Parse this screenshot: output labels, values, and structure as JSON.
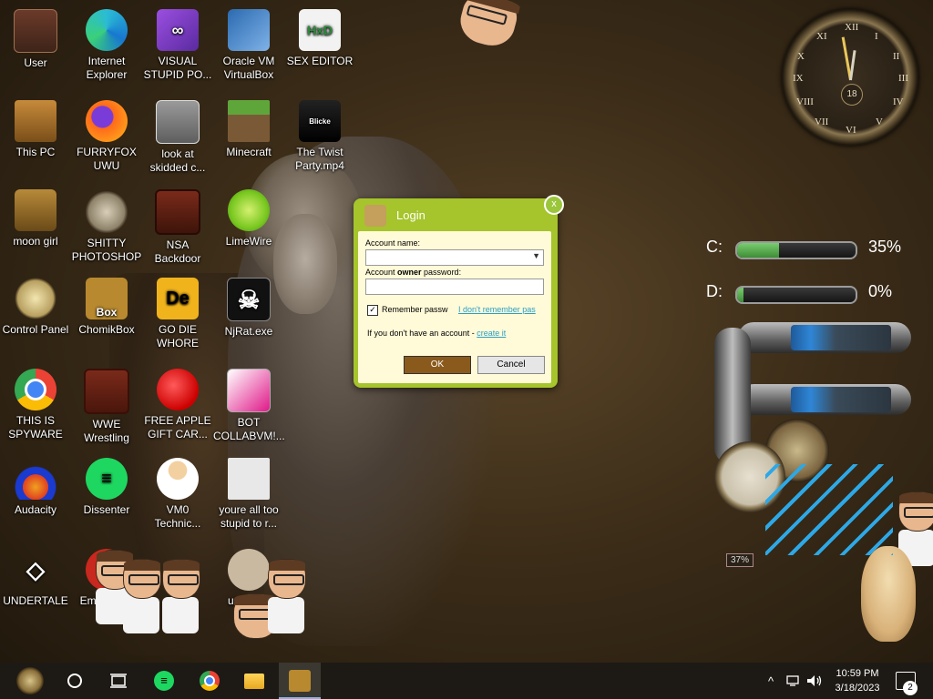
{
  "desktop": {
    "icons": [
      {
        "label": "User"
      },
      {
        "label": "Internet Explorer"
      },
      {
        "label": "VISUAL STUPID PO..."
      },
      {
        "label": "Oracle VM VirtualBox"
      },
      {
        "label": "SEX EDITOR"
      },
      {
        "label": "This PC"
      },
      {
        "label": "FURRYFOX UWU"
      },
      {
        "label": "look at skidded c..."
      },
      {
        "label": "Minecraft"
      },
      {
        "label": "The Twist Party.mp4"
      },
      {
        "label": "moon girl"
      },
      {
        "label": "SHITTY PHOTOSHOP"
      },
      {
        "label": "NSA Backdoor"
      },
      {
        "label": "LimeWire"
      },
      {
        "label": "Control Panel"
      },
      {
        "label": "ChomikBox"
      },
      {
        "label": "GO DIE WHORE"
      },
      {
        "label": "NjRat.exe"
      },
      {
        "label": "THIS IS SPYWARE"
      },
      {
        "label": "WWE Wrestling"
      },
      {
        "label": "FREE APPLE GIFT CAR..."
      },
      {
        "label": "BOT COLLABVM!..."
      },
      {
        "label": "Audacity"
      },
      {
        "label": "Dissenter"
      },
      {
        "label": "VM0 Technic..."
      },
      {
        "label": "youre all too stupid to r..."
      },
      {
        "label": "UNDERTALE"
      },
      {
        "label": "Emba Devi"
      },
      {
        "label": "us that b"
      }
    ],
    "icon_glyphs": {
      "hxd": "HxD",
      "chomik": "Box",
      "de": "De",
      "skull": "☠",
      "twist": "Blicke"
    }
  },
  "widgets": {
    "clock": {
      "numerals": [
        "XII",
        "I",
        "II",
        "III",
        "IV",
        "V",
        "VI",
        "VII",
        "VIII",
        "IX",
        "X",
        "XI"
      ],
      "date": "18"
    },
    "drives": [
      {
        "letter": "C:",
        "percent": "35%",
        "fill": 0.35
      },
      {
        "letter": "D:",
        "percent": "0%",
        "fill": 0.05
      }
    ],
    "gauge": {
      "label": "37%"
    }
  },
  "login_dialog": {
    "title": "Login",
    "close": "x",
    "account_name_label": "Account name:",
    "account_password_label_pre": "Account ",
    "account_password_label_bold": "owner",
    "account_password_label_post": " password:",
    "remember_label": "Remember passw",
    "remember_checked": "✓",
    "forgot_link": "I don't remember pas",
    "no_account_text": "If you don't have an account - ",
    "create_link": "create it",
    "ok_label": "OK",
    "cancel_label": "Cancel"
  },
  "taskbar": {
    "time": "10:59 PM",
    "date": "3/18/2023",
    "notification_count": "2",
    "tray_chevron": "^"
  }
}
